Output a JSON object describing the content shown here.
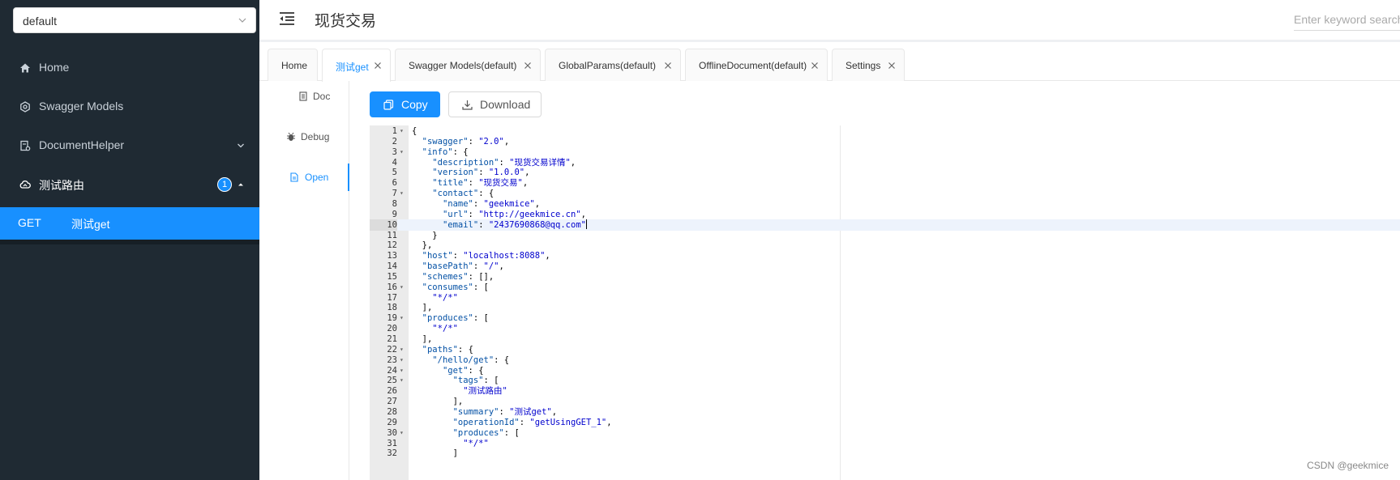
{
  "sidebar": {
    "group_select": "default",
    "menu": [
      {
        "label": "Home",
        "icon": "home-icon"
      },
      {
        "label": "Swagger Models",
        "icon": "gear-icon"
      },
      {
        "label": "DocumentHelper",
        "icon": "doc-icon"
      },
      {
        "label": "测试路由",
        "icon": "cloud-icon",
        "badge": "1"
      }
    ],
    "sub_item": {
      "method": "GET",
      "name": "测试get"
    }
  },
  "header": {
    "title": "现货交易",
    "search_placeholder": "Enter keyword search"
  },
  "tabs": [
    {
      "label": "Home",
      "closable": false
    },
    {
      "label": "测试get",
      "closable": true,
      "active": true
    },
    {
      "label": "Swagger Models(default)",
      "closable": true
    },
    {
      "label": "GlobalParams(default)",
      "closable": true
    },
    {
      "label": "OfflineDocument(default)",
      "closable": true
    },
    {
      "label": "Settings",
      "closable": true
    }
  ],
  "subtabs": [
    {
      "label": "Doc"
    },
    {
      "label": "Debug"
    },
    {
      "label": "Open",
      "active": true
    }
  ],
  "buttons": {
    "copy": "Copy",
    "download": "Download"
  },
  "editor": {
    "active_line": 10,
    "lines": [
      "{",
      "  \"swagger\": \"2.0\",",
      "  \"info\": {",
      "    \"description\": \"现货交易详情\",",
      "    \"version\": \"1.0.0\",",
      "    \"title\": \"现货交易\",",
      "    \"contact\": {",
      "      \"name\": \"geekmice\",",
      "      \"url\": \"http://geekmice.cn\",",
      "      \"email\": \"2437690868@qq.com\"",
      "    }",
      "  },",
      "  \"host\": \"localhost:8088\",",
      "  \"basePath\": \"/\",",
      "  \"schemes\": [],",
      "  \"consumes\": [",
      "    \"*/*\"",
      "  ],",
      "  \"produces\": [",
      "    \"*/*\"",
      "  ],",
      "  \"paths\": {",
      "    \"/hello/get\": {",
      "      \"get\": {",
      "        \"tags\": [",
      "          \"测试路由\"",
      "        ],",
      "        \"summary\": \"测试get\",",
      "        \"operationId\": \"getUsingGET_1\",",
      "        \"produces\": [",
      "          \"*/*\"",
      "        ]"
    ],
    "fold_lines": [
      1,
      3,
      7,
      16,
      19,
      22,
      23,
      24,
      25,
      30
    ]
  },
  "watermark": "CSDN @geekmice",
  "colors": {
    "primary": "#1890ff",
    "sidebar_bg": "#1f2a33"
  }
}
